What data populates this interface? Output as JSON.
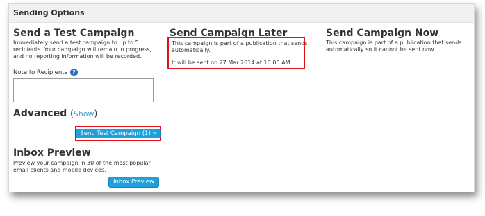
{
  "panel": {
    "title": "Sending Options"
  },
  "test": {
    "title": "Send a Test Campaign",
    "description": "Immediately send a test campaign to up to 5 recipients. Your campaign will remain in progress, and no reporting information will be recorded.",
    "note_label": "Note to Recipients",
    "note_value": "",
    "help_icon": "?"
  },
  "advanced": {
    "title": "Advanced",
    "open_paren": "(",
    "show_link": "Show",
    "close_paren": ")"
  },
  "send_test_button": "Send Test Campaign (1) »",
  "inbox": {
    "title": "Inbox Preview",
    "description": "Preview your campaign in 30 of the most popular email clients and mobile devices.",
    "button": "Inbox Preview"
  },
  "later": {
    "title": "Send Campaign Later",
    "line1": "This campaign is part of a publication that sends automatically.",
    "line2": "It will be sent on 27 Mar 2014 at 10:00 AM."
  },
  "now": {
    "title": "Send Campaign Now",
    "description": "This campaign is part of a publication that sends automatically so it cannot be sent now."
  },
  "colors": {
    "button_blue": "#1ea0dc",
    "highlight_red": "#e0131b",
    "link_blue": "#3a9bd6"
  }
}
